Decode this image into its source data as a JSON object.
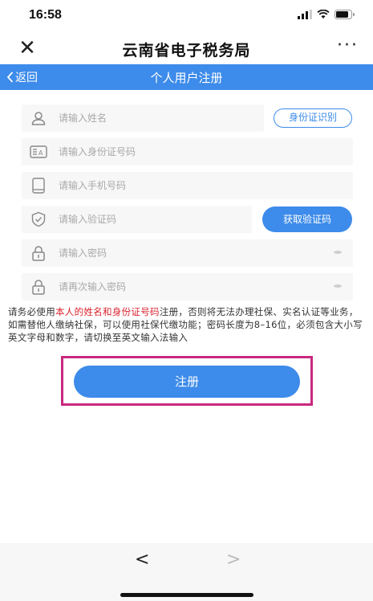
{
  "status_bar": {
    "time": "16:58"
  },
  "title_bar": {
    "title": "云南省电子税务局",
    "close_icon": "close-icon",
    "more_label": "···"
  },
  "nav_bar": {
    "back_label": "返回",
    "title": "个人用户注册"
  },
  "form": {
    "name": {
      "placeholder": "请输入姓名",
      "icon": "user-icon"
    },
    "id_recognize_label": "身份证识别",
    "id_number": {
      "placeholder": "请输入身份证号码",
      "icon": "id-card-icon"
    },
    "phone": {
      "placeholder": "请输入手机号码",
      "icon": "phone-icon"
    },
    "code": {
      "placeholder": "请输入验证码",
      "icon": "shield-icon"
    },
    "get_code_label": "获取验证码",
    "password": {
      "placeholder": "请输入密码",
      "icon": "lock-icon"
    },
    "password_confirm": {
      "placeholder": "请再次输入密码",
      "icon": "lock-icon"
    }
  },
  "notice": {
    "part1": "请务必使用",
    "highlight": "本人的姓名和身份证号码",
    "part2": "注册，否则将无法办理社保、实名认证等业务，如需替他人缴纳社保，可以使用社保代缴功能；密码长度为8–16位，必须包含大小写英文字母和数字，请切换至英文输入法输入"
  },
  "register_label": "注册",
  "bottom_bar": {
    "prev_label": "<",
    "next_label": ">"
  },
  "colors": {
    "accent": "#3d8bea",
    "highlight": "#d9232e",
    "frame": "#c8297f"
  }
}
